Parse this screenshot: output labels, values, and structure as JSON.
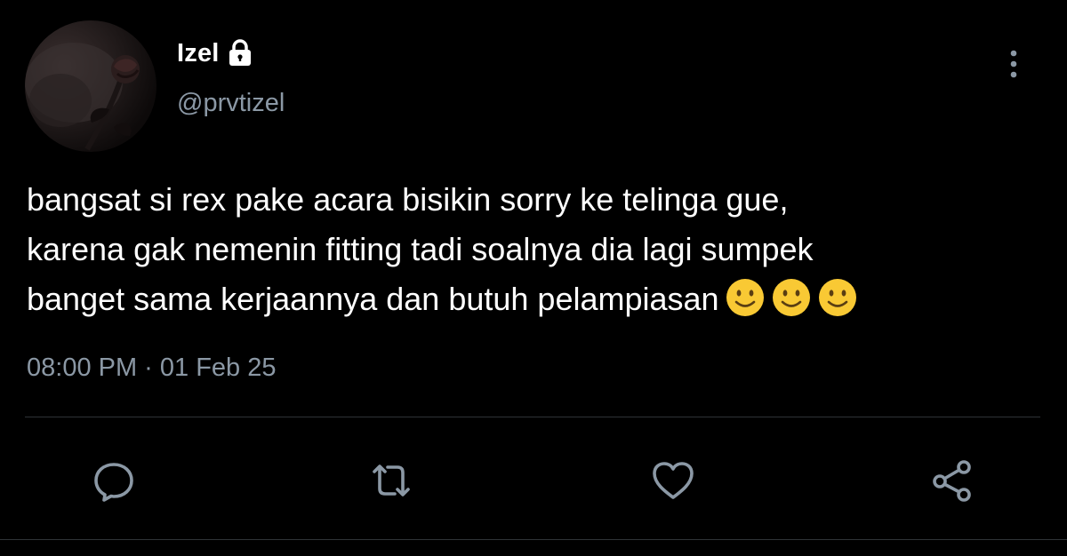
{
  "author": {
    "display_name": "Izel",
    "handle": "@prvtizel",
    "protected_icon": "lock-icon",
    "avatar_icon": "rose-avatar"
  },
  "tweet": {
    "lines": [
      "bangsat si rex pake acara bisikin sorry ke telinga gue,",
      "karena gak nemenin fitting tadi soalnya dia lagi sumpek",
      "banget sama kerjaannya dan butuh pelampiasan"
    ],
    "emojis": [
      "slightly-smiling-face",
      "slightly-smiling-face",
      "slightly-smiling-face"
    ],
    "timestamp": "08:00 PM · 01 Feb 25"
  },
  "actions": [
    {
      "name": "reply",
      "icon": "comment-icon"
    },
    {
      "name": "retweet",
      "icon": "retweet-icon"
    },
    {
      "name": "like",
      "icon": "heart-icon"
    },
    {
      "name": "share",
      "icon": "share-icon"
    }
  ],
  "menu": {
    "icon": "more-vertical-icon"
  },
  "colors": {
    "background": "#000000",
    "primary_text": "#ffffff",
    "secondary_text": "#8b98a5",
    "icon": "#8b98a5",
    "divider": "#2f3336",
    "emoji_yellow": "#f9c934"
  }
}
